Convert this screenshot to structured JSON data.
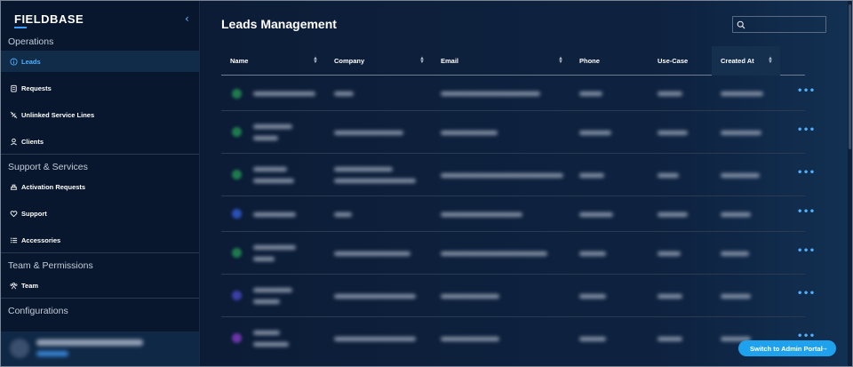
{
  "brand": {
    "name": "FIELDBASE",
    "accent": "#3aa0ff"
  },
  "sidebar": {
    "sections": [
      {
        "title": "Operations"
      },
      {
        "title": "Support & Services"
      },
      {
        "title": "Team & Permissions"
      },
      {
        "title": "Configurations"
      }
    ],
    "items": [
      {
        "label": "Leads",
        "icon": "info-circle-icon",
        "active": true
      },
      {
        "label": "Requests",
        "icon": "clipboard-icon"
      },
      {
        "label": "Unlinked Service Lines",
        "icon": "unlink-icon"
      },
      {
        "label": "Clients",
        "icon": "user-icon"
      },
      {
        "label": "Activation Requests",
        "icon": "activation-icon"
      },
      {
        "label": "Support",
        "icon": "heart-handshake-icon"
      },
      {
        "label": "Accessories",
        "icon": "list-icon"
      },
      {
        "label": "Team",
        "icon": "team-icon"
      }
    ],
    "collapse_icon": "chevron-left-icon"
  },
  "main": {
    "title": "Leads Management",
    "search": {
      "placeholder": "",
      "value": "",
      "icon": "search-icon"
    },
    "table": {
      "columns": [
        "Name",
        "Company",
        "Email",
        "Phone",
        "Use-Case",
        "Created At"
      ],
      "row_count": 7
    },
    "switch_button": {
      "label": "Switch to Admin Portal",
      "icon": "arrow-right-icon"
    }
  },
  "colors": {
    "background": "#0a1a33",
    "sidebar": "#08172d",
    "active": "#4fb0ff",
    "button": "#1fa2ee"
  }
}
